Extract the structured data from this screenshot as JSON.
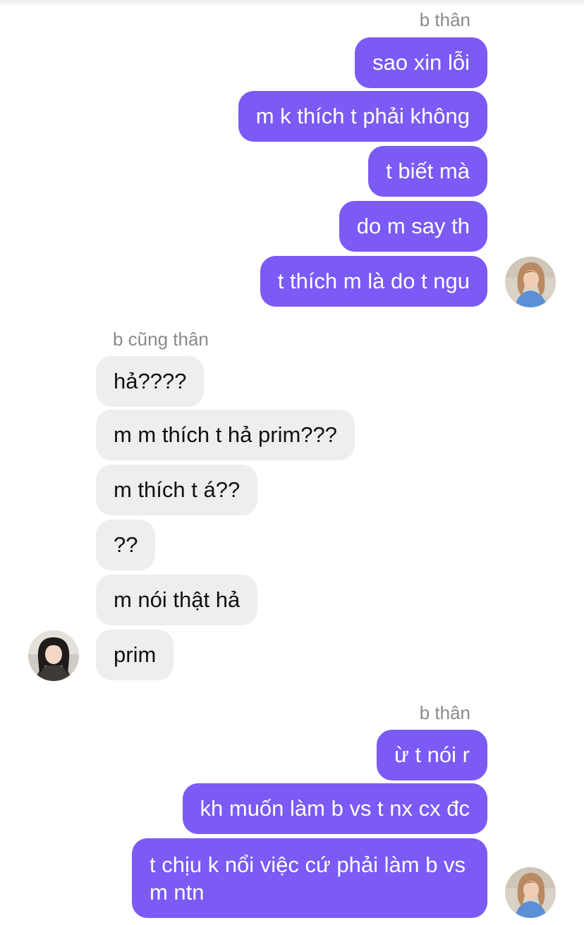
{
  "groups": [
    {
      "sender": "b thân",
      "messages": [
        "sao xin lỗi",
        "m k thích t phải không",
        "t biết mà",
        "do m say th",
        "t thích m là do t ngu"
      ]
    },
    {
      "sender": "b cũng thân",
      "messages": [
        "hả????",
        "m m thích t hả prim???",
        "m thích t á??",
        "??",
        "m nói thật hả",
        "prim"
      ]
    },
    {
      "sender": "b thân",
      "messages": [
        "ừ t nói r",
        "kh muốn làm b vs t nx cx đc",
        "t chịu k nổi việc cứ phải làm b vs m ntn"
      ]
    }
  ],
  "colors": {
    "outgoing_bubble": "#7b5af5",
    "incoming_bubble": "#eeeef0",
    "sender_label": "#8a8a8e"
  },
  "icons": {
    "avatar_self": "avatar-self-photo",
    "avatar_friend": "avatar-friend-photo"
  }
}
